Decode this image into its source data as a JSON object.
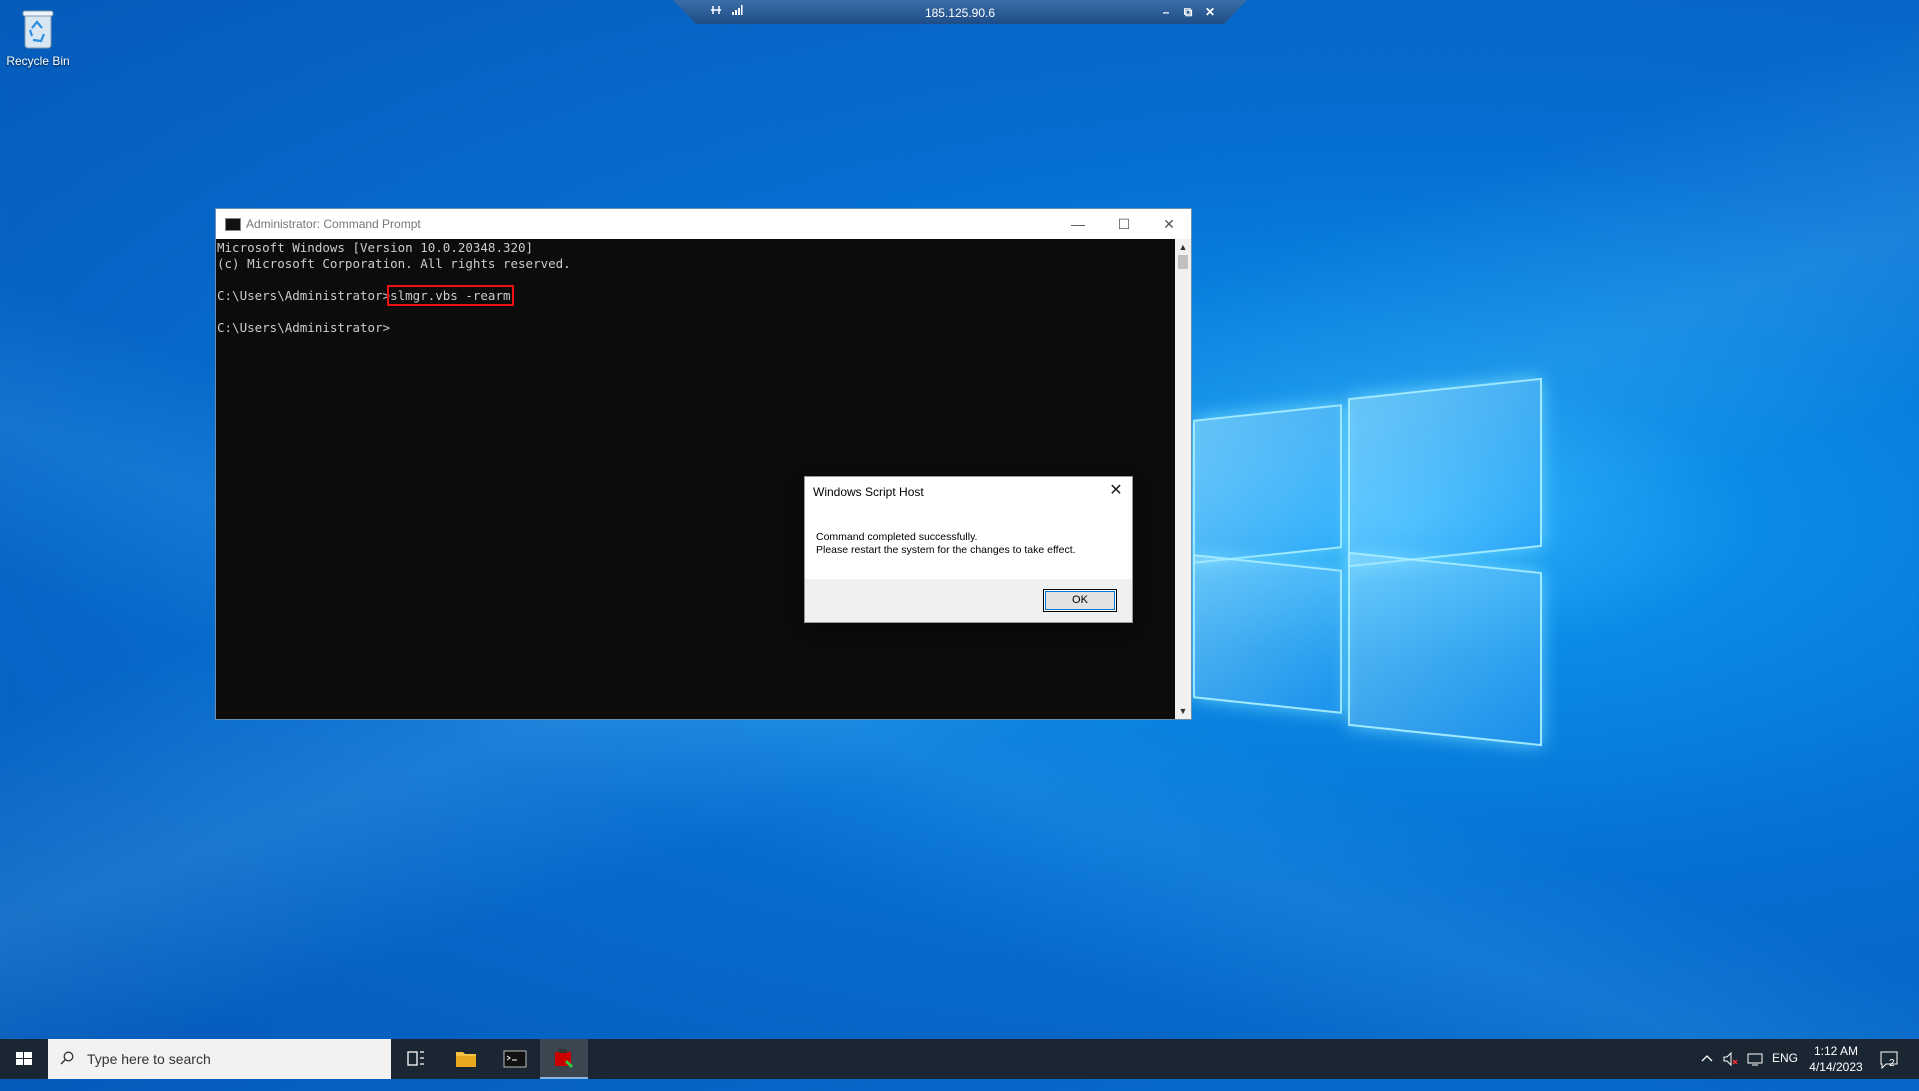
{
  "desktop": {
    "recycle_bin_label": "Recycle Bin",
    "icons": {
      "recycle_bin": "recycle-bin-icon"
    }
  },
  "rdp_bar": {
    "title": "185.125.90.6",
    "pin_icon": "pin-icon",
    "signal_icon": "signal-icon",
    "minimize": "–",
    "restore": "⧉",
    "close": "✕"
  },
  "cmd_window": {
    "title": "Administrator: Command Prompt",
    "lines": [
      "Microsoft Windows [Version 10.0.20348.320]",
      "(c) Microsoft Corporation. All rights reserved."
    ],
    "prompt": "C:\\Users\\Administrator>",
    "command": "slmgr.vbs -rearm",
    "prompt2": "C:\\Users\\Administrator>",
    "minimize": "—",
    "maximize": "☐",
    "close": "✕"
  },
  "dialog": {
    "title": "Windows Script Host",
    "message_line1": "Command completed successfully.",
    "message_line2": "Please restart the system for the changes to take effect.",
    "ok_label": "OK",
    "close": "✕"
  },
  "taskbar": {
    "search_placeholder": "Type here to search",
    "language": "ENG",
    "time": "1:12 AM",
    "date": "4/14/2023",
    "notification_count": "2",
    "colors": {
      "background": "#1b2633",
      "active_underline": "#8ab4e0"
    }
  }
}
